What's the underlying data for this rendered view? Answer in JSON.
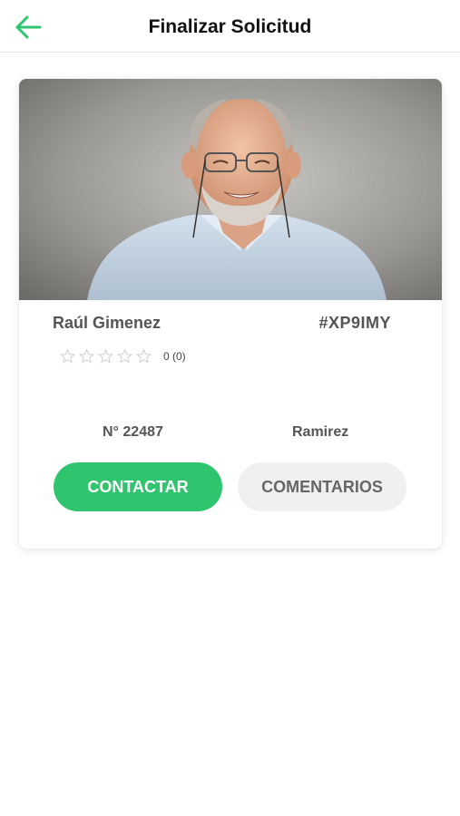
{
  "header": {
    "title": "Finalizar Solicitud",
    "back_icon": "arrow-left-icon"
  },
  "colors": {
    "accent": "#2fc46e",
    "back_arrow": "#2fc46e",
    "secondary_button_bg": "#f0f0f0"
  },
  "driver": {
    "name": "Raúl Gimenez",
    "code": "#XP9IMY",
    "rating_stars": 0,
    "rating_max": 5,
    "rating_text": "0 (0)",
    "number": "N° 22487",
    "district": "Ramirez"
  },
  "actions": {
    "contact_label": "CONTACTAR",
    "comments_label": "COMENTARIOS"
  }
}
